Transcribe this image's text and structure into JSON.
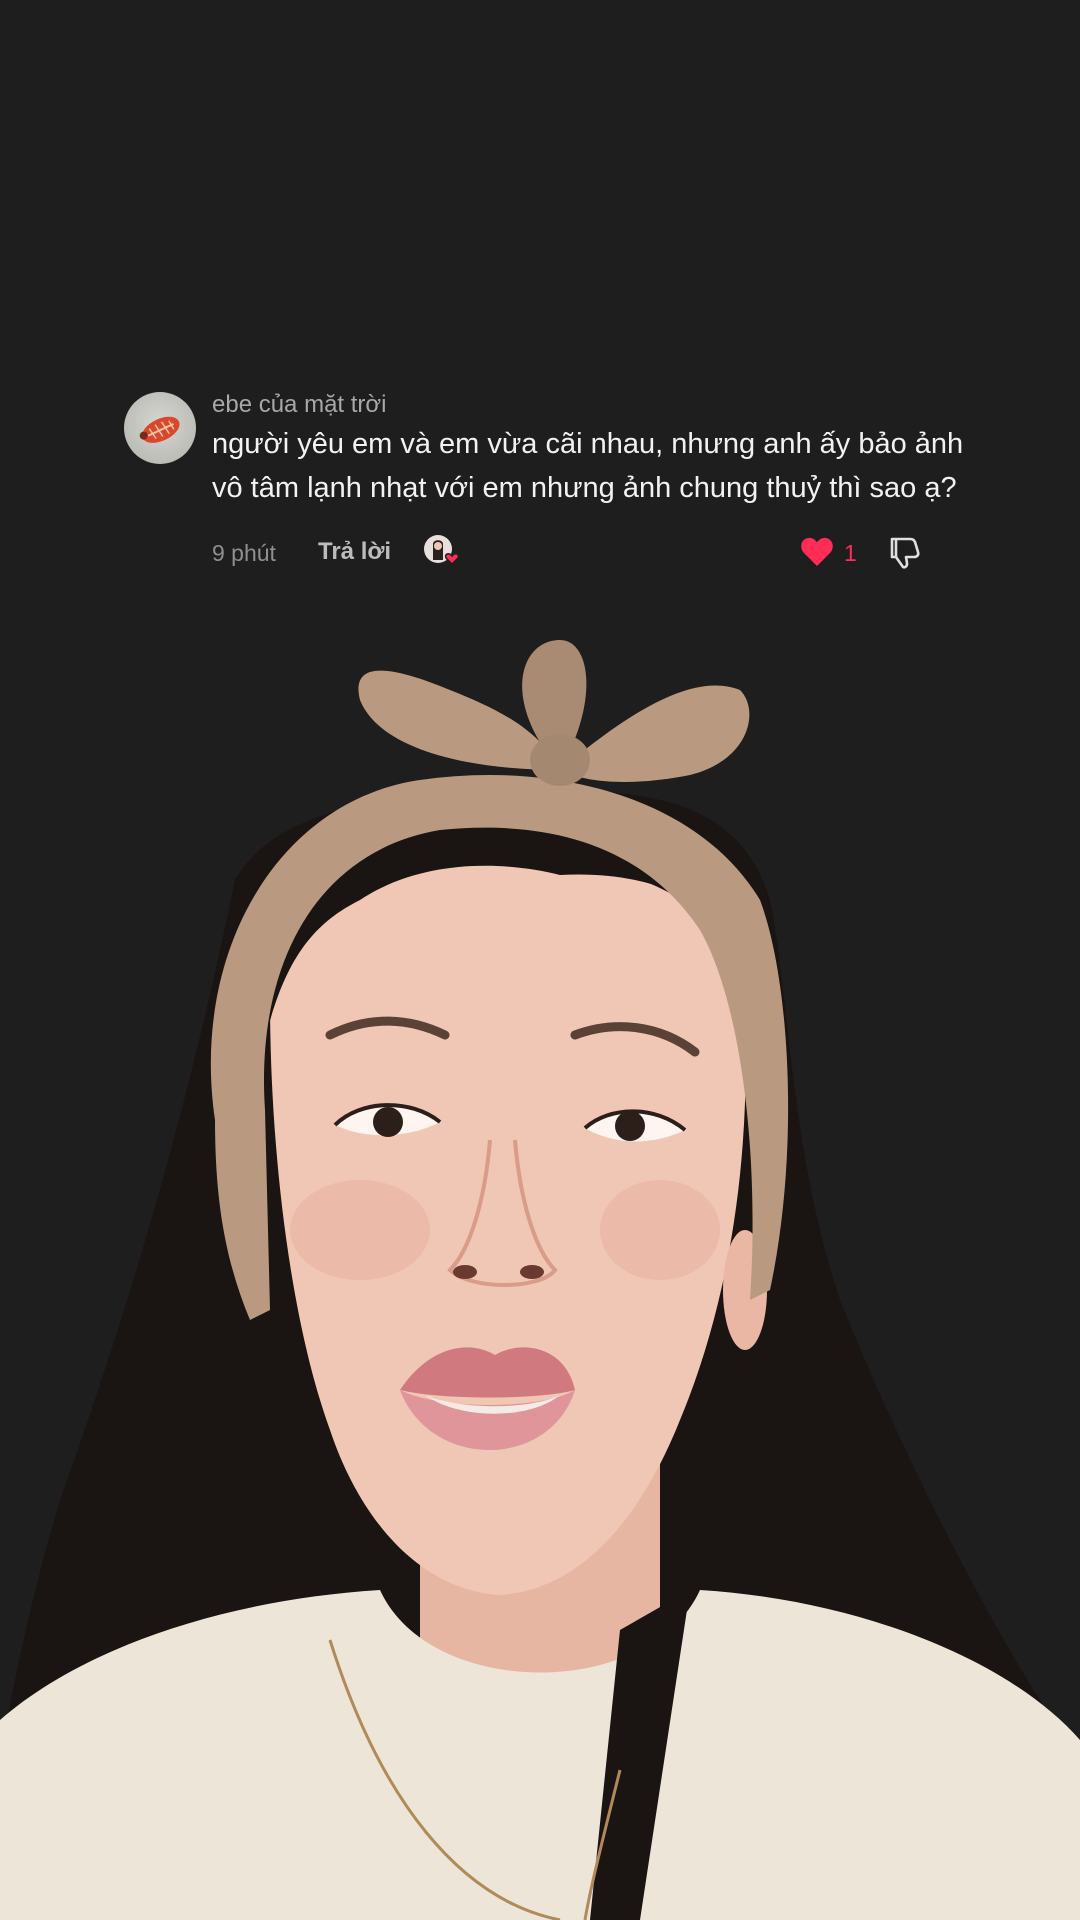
{
  "comment": {
    "username": "ebe của mặt trời",
    "text": "người yêu em và em vừa cãi nhau, nhưng anh ấy bảo ảnh vô tâm lạnh nhạt với em nhưng ảnh chung thuỷ thì sao ạ?",
    "time": "9 phút",
    "reply_label": "Trả lời",
    "like_count": "1"
  },
  "colors": {
    "background": "#1e1e1e",
    "like_accent": "#ff2d55",
    "username": "#a8a8a8",
    "comment_text": "#f2f2f2"
  },
  "icons": {
    "like": "heart-icon",
    "dislike": "thumbs-down-icon",
    "creator_liked": "creator-liked-badge"
  }
}
